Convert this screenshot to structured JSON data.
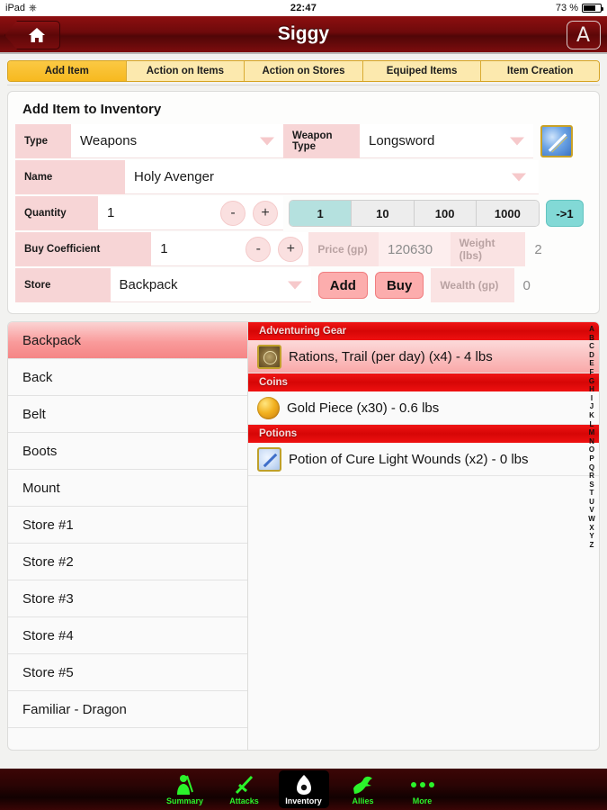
{
  "statusbar": {
    "device": "iPad",
    "wifi_icon": "wifi-icon",
    "time": "22:47",
    "battery_pct": "73 %"
  },
  "navbar": {
    "title": "Siggy",
    "home_icon": "home-icon",
    "right_button_label": "A"
  },
  "tabs": [
    {
      "label": "Add Item",
      "active": true
    },
    {
      "label": "Action on Items",
      "active": false
    },
    {
      "label": "Action on Stores",
      "active": false
    },
    {
      "label": "Equiped Items",
      "active": false
    },
    {
      "label": "Item Creation",
      "active": false
    }
  ],
  "form": {
    "title": "Add Item to Inventory",
    "type_label": "Type",
    "type_value": "Weapons",
    "weapon_type_label": "Weapon Type",
    "weapon_type_value": "Longsword",
    "item_icon": "sword-item-icon",
    "name_label": "Name",
    "name_value": "Holy Avenger",
    "quantity_label": "Quantity",
    "quantity_value": "1",
    "minus_label": "-",
    "plus_label": "+",
    "quantity_steps": [
      "1",
      "10",
      "100",
      "1000"
    ],
    "quantity_step_selected": "1",
    "reset_label": "->1",
    "buy_coefficient_label": "Buy Coefficient",
    "buy_coefficient_value": "1",
    "price_label": "Price (gp)",
    "price_value": "120630",
    "weight_label": "Weight (lbs)",
    "weight_value": "2",
    "store_label": "Store",
    "store_value": "Backpack",
    "add_label": "Add",
    "buy_label": "Buy",
    "wealth_label": "Wealth (gp)",
    "wealth_value": "0"
  },
  "stores": [
    {
      "label": "Backpack",
      "selected": true
    },
    {
      "label": "Back",
      "selected": false
    },
    {
      "label": "Belt",
      "selected": false
    },
    {
      "label": "Boots",
      "selected": false
    },
    {
      "label": "Mount",
      "selected": false
    },
    {
      "label": "Store #1",
      "selected": false
    },
    {
      "label": "Store #2",
      "selected": false
    },
    {
      "label": "Store #3",
      "selected": false
    },
    {
      "label": "Store #4",
      "selected": false
    },
    {
      "label": "Store #5",
      "selected": false
    },
    {
      "label": "Familiar - Dragon",
      "selected": false
    }
  ],
  "inventory": [
    {
      "section": "Adventuring Gear",
      "items": [
        {
          "label": "Rations, Trail (per day) (x4) - 4 lbs",
          "icon": "rations-icon",
          "selected": true
        }
      ]
    },
    {
      "section": "Coins",
      "items": [
        {
          "label": "Gold Piece (x30) - 0.6 lbs",
          "icon": "gold-piece-icon",
          "selected": false
        }
      ]
    },
    {
      "section": "Potions",
      "items": [
        {
          "label": "Potion of Cure Light Wounds (x2) - 0 lbs",
          "icon": "potion-icon",
          "selected": false
        }
      ]
    }
  ],
  "alpha_index": [
    "A",
    "B",
    "C",
    "D",
    "E",
    "F",
    "G",
    "H",
    "I",
    "J",
    "K",
    "L",
    "M",
    "N",
    "O",
    "P",
    "Q",
    "R",
    "S",
    "T",
    "U",
    "V",
    "W",
    "X",
    "Y",
    "Z"
  ],
  "bottom_tabs": [
    {
      "label": "Summary",
      "icon": "character-icon",
      "active": false
    },
    {
      "label": "Attacks",
      "icon": "crossed-swords-icon",
      "active": false
    },
    {
      "label": "Inventory",
      "icon": "bag-icon",
      "active": true
    },
    {
      "label": "Allies",
      "icon": "dragon-icon",
      "active": false
    },
    {
      "label": "More",
      "icon": "ellipsis-icon",
      "active": false
    }
  ],
  "colors": {
    "nav_red": "#6d0a0b",
    "tab_yellow": "#f7b91f",
    "section_red": "#d60606",
    "accent_pink": "#f7d5d6",
    "teal": "#82d9d6",
    "green": "#2bf42b"
  }
}
